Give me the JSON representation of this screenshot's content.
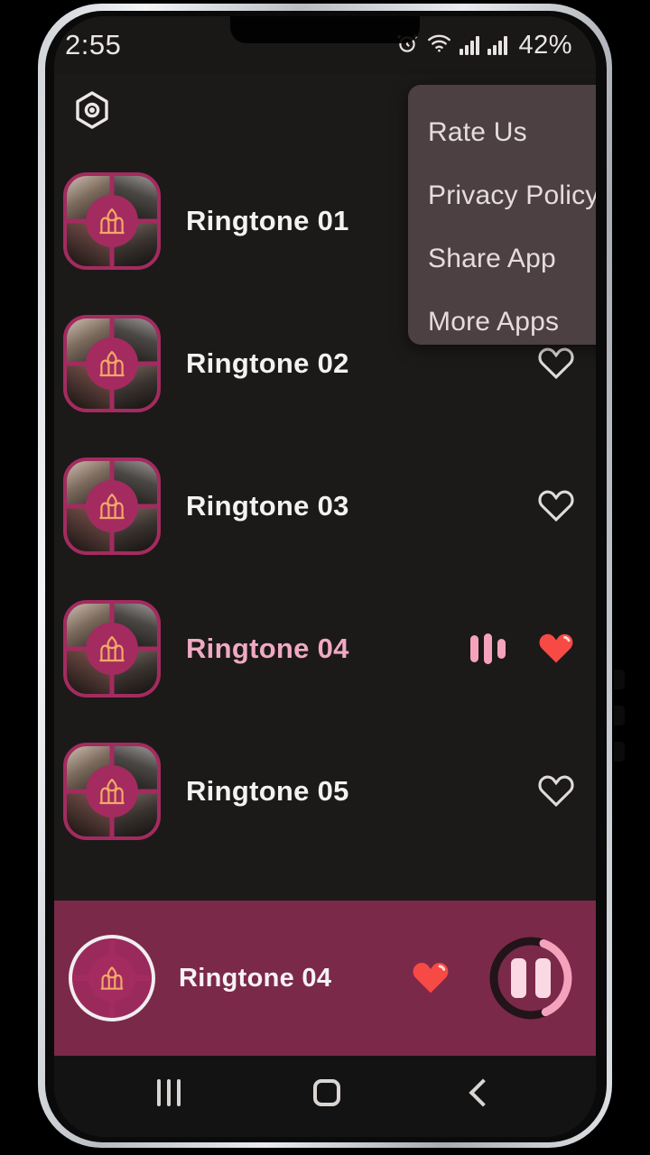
{
  "status_bar": {
    "time": "2:55",
    "battery": "42%",
    "icons": [
      "alarm-icon",
      "wifi-icon",
      "signal-icon",
      "signal-icon"
    ]
  },
  "app_header": {
    "menu_icon": "hexagon-settings-icon"
  },
  "dropdown_menu": {
    "visible": true,
    "background_color": "#4c4042",
    "items": [
      {
        "label": "Rate Us"
      },
      {
        "label": "Privacy Policy"
      },
      {
        "label": "Share App"
      },
      {
        "label": "More Apps"
      }
    ]
  },
  "ringtone_list": {
    "rows": [
      {
        "title": "Ringtone 01",
        "favorite": false,
        "playing": false,
        "heart_icon": "heart-outline-icon"
      },
      {
        "title": "Ringtone 02",
        "favorite": false,
        "playing": false,
        "heart_icon": "heart-outline-icon"
      },
      {
        "title": "Ringtone 03",
        "favorite": false,
        "playing": false,
        "heart_icon": "heart-outline-icon"
      },
      {
        "title": "Ringtone 04",
        "favorite": true,
        "playing": true,
        "heart_icon": "heart-filled-icon"
      },
      {
        "title": "Ringtone 05",
        "favorite": false,
        "playing": false,
        "heart_icon": "heart-outline-icon"
      }
    ]
  },
  "player_bar": {
    "title": "Ringtone 04",
    "favorite": true,
    "heart_icon": "heart-filled-icon",
    "play_state": "playing",
    "play_button_icon": "pause-icon",
    "progress_percent": 38,
    "background_color": "#7b2949",
    "accent_color": "#f5a3bd"
  },
  "nav_bar": {
    "items": [
      {
        "name": "recents",
        "icon": "recents-icon"
      },
      {
        "name": "home",
        "icon": "home-icon"
      },
      {
        "name": "back",
        "icon": "back-icon"
      }
    ]
  },
  "colors": {
    "screen_background": "#1c1919",
    "accent_magenta": "#a32b5f",
    "heart_red": "#f74a44",
    "pink": "#f5a3bd",
    "text_primary": "#f4f2f1"
  }
}
